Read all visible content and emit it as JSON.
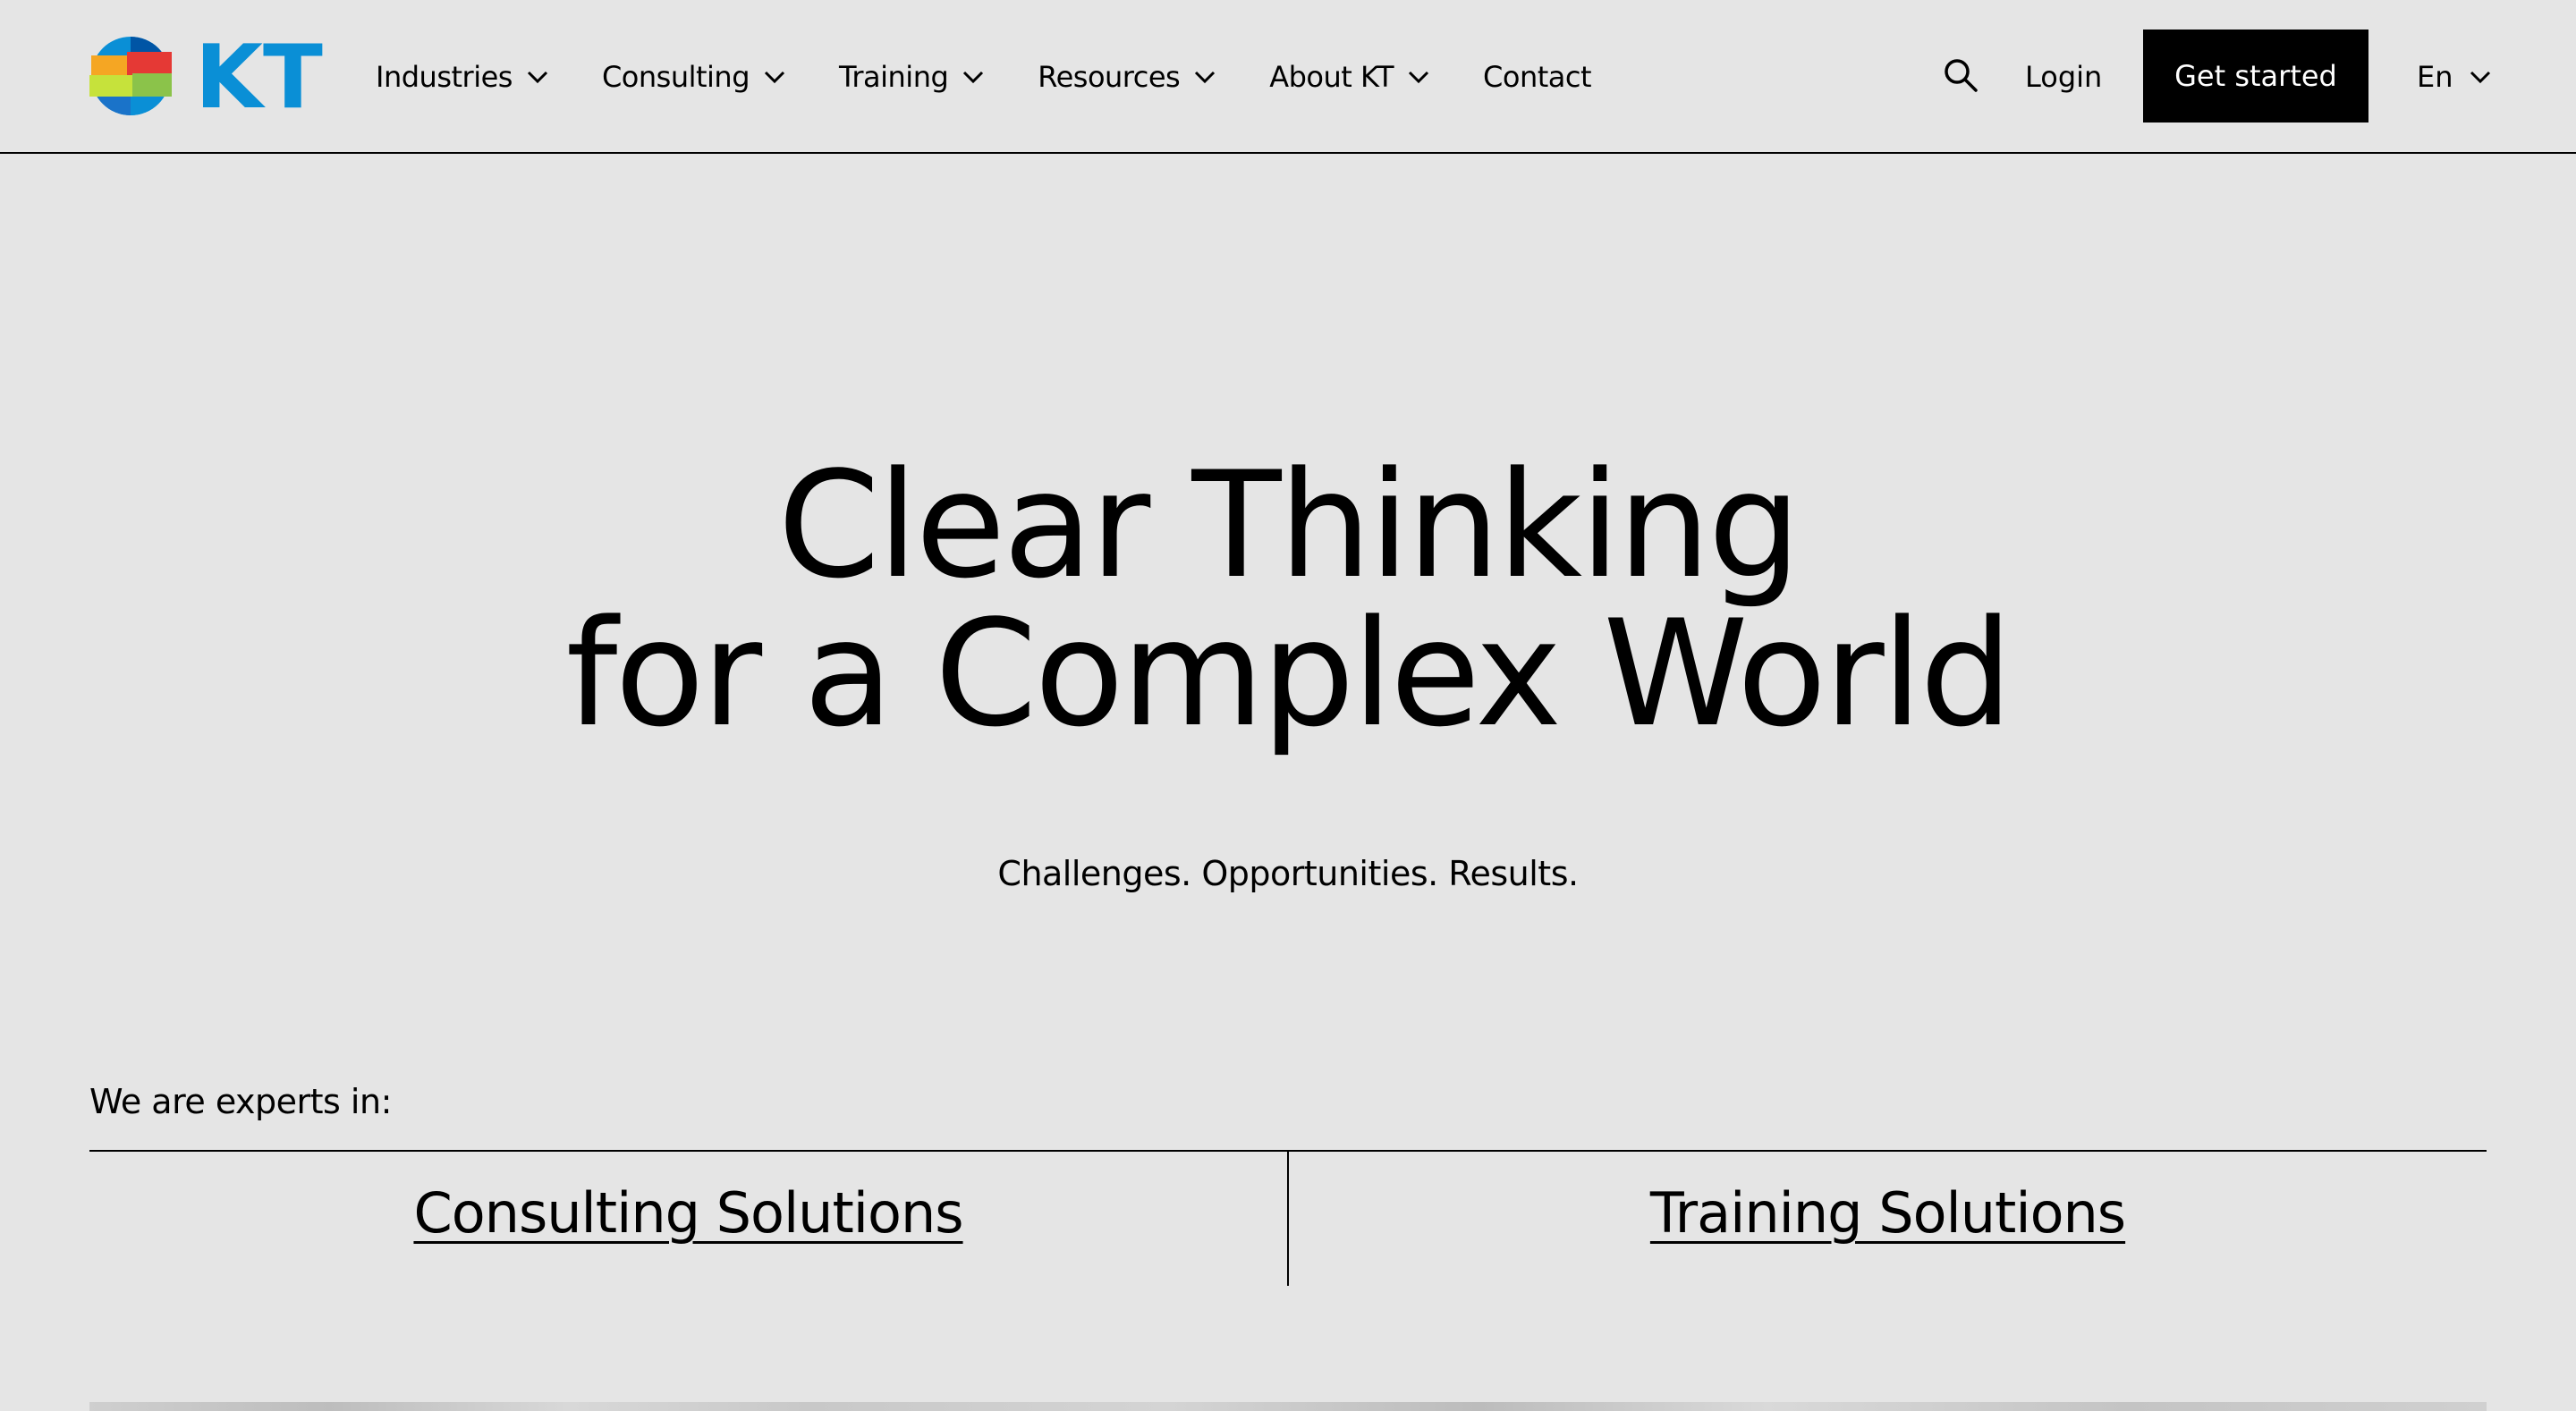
{
  "header": {
    "logo_text": "KT",
    "nav": [
      {
        "label": "Industries",
        "has_dropdown": true
      },
      {
        "label": "Consulting",
        "has_dropdown": true
      },
      {
        "label": "Training",
        "has_dropdown": true
      },
      {
        "label": "Resources",
        "has_dropdown": true
      },
      {
        "label": "About KT",
        "has_dropdown": true
      },
      {
        "label": "Contact",
        "has_dropdown": false
      }
    ],
    "search_icon": "search-icon",
    "login_label": "Login",
    "cta_label": "Get started",
    "language": "En"
  },
  "hero": {
    "title_line1": "Clear Thinking",
    "title_line2": "for a Complex World",
    "subtitle": "Challenges. Opportunities. Results."
  },
  "experts": {
    "label": "We are experts in:",
    "solutions": [
      {
        "label": "Consulting Solutions"
      },
      {
        "label": "Training Solutions"
      }
    ]
  },
  "colors": {
    "background": "#e5e5e5",
    "cta_bg": "#000000",
    "cta_text": "#ffffff",
    "logo_blue": "#0a8fd6",
    "logo_dark_blue": "#0055a5"
  }
}
